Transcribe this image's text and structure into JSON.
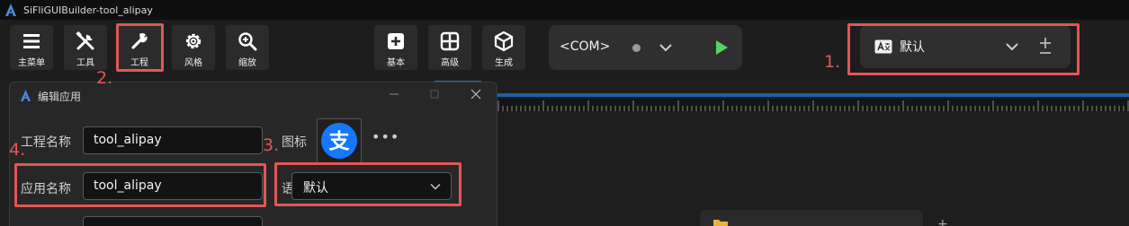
{
  "app": {
    "title": "SiFliGUIBuilder-tool_alipay"
  },
  "toolbar": {
    "buttons": [
      {
        "label": "主菜单",
        "icon": "menu-icon"
      },
      {
        "label": "工具",
        "icon": "tools-icon"
      },
      {
        "label": "工程",
        "icon": "wrench-icon"
      },
      {
        "label": "风格",
        "icon": "gear-icon"
      },
      {
        "label": "缩放",
        "icon": "zoom-in-icon"
      },
      {
        "label": "基本",
        "icon": "plus-square-icon"
      },
      {
        "label": "高级",
        "icon": "grid-icon"
      },
      {
        "label": "生成",
        "icon": "cube-icon"
      }
    ]
  },
  "com": {
    "port": "<COM>",
    "status_color": "#9a9a9a",
    "run_color": "#5bcf6a"
  },
  "language_bar": {
    "value": "默认"
  },
  "annotations": {
    "marker_1": "1.",
    "marker_2": "2.",
    "marker_3": "3.",
    "marker_4": "4.",
    "color": "#e35656"
  },
  "dialog": {
    "title": "编辑应用",
    "project_name_label": "工程名称",
    "project_name_value": "tool_alipay",
    "icon_label": "图标",
    "icon_glyph": "支",
    "icon_color": "#1677ff",
    "more": "•••",
    "app_name_label": "应用名称",
    "app_name_value": "tool_alipay",
    "language_label": "语言",
    "language_value": "默认"
  },
  "colors": {
    "accent_blue": "#1c5fa8",
    "background": "#1c1c1c"
  }
}
